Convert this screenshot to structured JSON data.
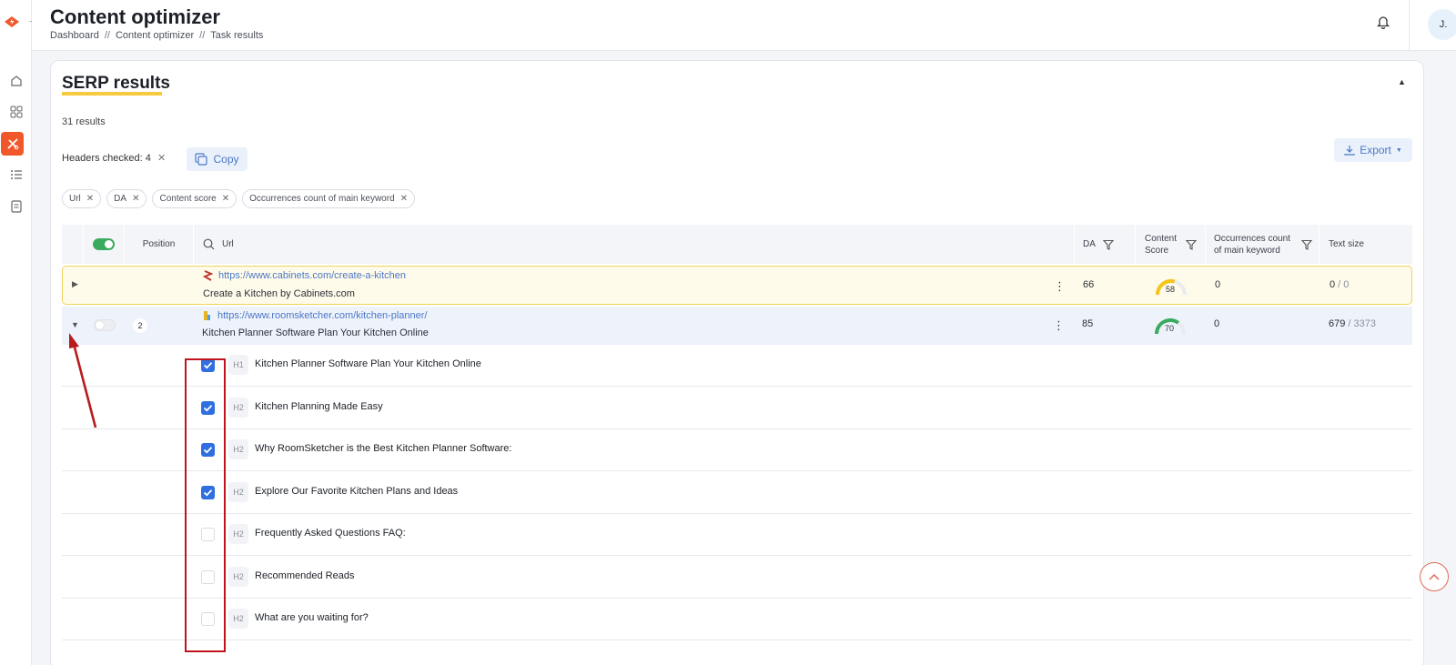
{
  "app": {
    "title": "Content optimizer",
    "breadcrumb": [
      "Dashboard",
      "Content optimizer",
      "Task results"
    ],
    "breadcrumb_sep": "//",
    "avatar": "J."
  },
  "colors": {
    "accent": "#f0572a",
    "link": "#4a78c7",
    "highlight_underline": "#f9c93e",
    "checkbox": "#2f6fe0",
    "toggle_on": "#3aaa5f",
    "annotation": "#c0141c"
  },
  "serp": {
    "title": "SERP results",
    "results_count": "31 results",
    "headers_checked": "Headers checked: 4",
    "copy_label": "Copy",
    "export_label": "Export",
    "chips": [
      "Url",
      "DA",
      "Content score",
      "Occurrences count of main keyword"
    ]
  },
  "table": {
    "columns": {
      "position": "Position",
      "url": "Url",
      "da": "DA",
      "content_score_1": "Content",
      "content_score_2": "Score",
      "occurrences_1": "Occurrences count",
      "occurrences_2": "of main keyword",
      "text_size": "Text size"
    },
    "rows": [
      {
        "position": "",
        "url": "https://www.cabinets.com/create-a-kitchen",
        "title": "Create a Kitchen by Cabinets.com",
        "da": "66",
        "content_score": "58",
        "content_score_value": 58,
        "occurrences": "0",
        "text_size_a": "0",
        "text_size_b": "/ 0"
      },
      {
        "position": "2",
        "url": "https://www.roomsketcher.com/kitchen-planner/",
        "title": "Kitchen Planner Software Plan Your Kitchen Online",
        "da": "85",
        "content_score": "70",
        "content_score_value": 70,
        "occurrences": "0",
        "text_size_a": "679",
        "text_size_b": "/ 3373"
      }
    ],
    "headings": [
      {
        "tag": "H1",
        "text": "Kitchen Planner Software Plan Your Kitchen Online",
        "checked": true
      },
      {
        "tag": "H2",
        "text": "Kitchen Planning Made Easy",
        "checked": true
      },
      {
        "tag": "H2",
        "text": "Why RoomSketcher is the Best Kitchen Planner Software:",
        "checked": true
      },
      {
        "tag": "H2",
        "text": "Explore Our Favorite Kitchen Plans and Ideas",
        "checked": true
      },
      {
        "tag": "H2",
        "text": "Frequently Asked Questions FAQ:",
        "checked": false
      },
      {
        "tag": "H2",
        "text": "Recommended Reads",
        "checked": false
      },
      {
        "tag": "H2",
        "text": "What are you waiting for?",
        "checked": false
      }
    ]
  }
}
